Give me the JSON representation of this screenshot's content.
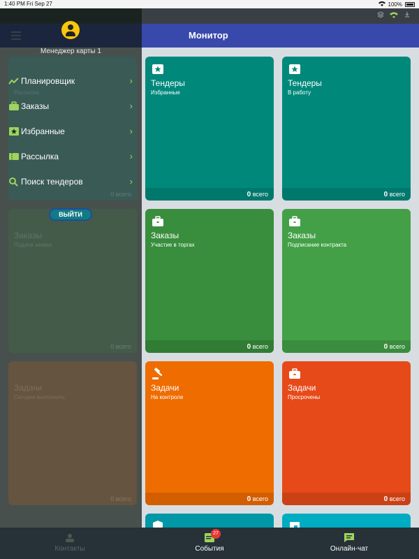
{
  "status": {
    "time": "1:40 PM",
    "date": "Fri Sep 27",
    "battery": "100%"
  },
  "header": {
    "title": "Монитор"
  },
  "drawer": {
    "username": "Менеджер карты 1",
    "items": [
      {
        "label": "Планировщик",
        "icon": "chart-line-icon"
      },
      {
        "label": "Заказы",
        "icon": "briefcase-icon"
      },
      {
        "label": "Избранные",
        "icon": "star-ticket-icon"
      },
      {
        "label": "Рассылка",
        "icon": "ticket-icon"
      },
      {
        "label": "Поиск тендеров",
        "icon": "search-icon"
      }
    ],
    "logout": "ВЫЙТИ",
    "ghost_cards": [
      {
        "t1": "",
        "t2": "Рассылка",
        "count": "0 всего"
      },
      {
        "t1": "Заказы",
        "t2": "Подача заявки",
        "count": "0 всего"
      },
      {
        "t1": "Задачи",
        "t2": "Сегодня выполнить",
        "count": "0 всего"
      }
    ]
  },
  "cards": [
    {
      "title": "Тендеры",
      "subtitle": "Избранные",
      "count": "0",
      "unit": "всего",
      "color": "#00897b",
      "icon": "star-ticket-icon"
    },
    {
      "title": "Тендеры",
      "subtitle": "В работу",
      "count": "0",
      "unit": "всего",
      "color": "#00897b",
      "icon": "star-ticket-icon"
    },
    {
      "title": "Заказы",
      "subtitle": "Участие в торгах",
      "count": "0",
      "unit": "всего",
      "color": "#388e3c",
      "icon": "briefcase-icon"
    },
    {
      "title": "Заказы",
      "subtitle": "Подписание контракта",
      "count": "0",
      "unit": "всего",
      "color": "#43a047",
      "icon": "briefcase-icon"
    },
    {
      "title": "Задачи",
      "subtitle": "На контроле",
      "count": "0",
      "unit": "всего",
      "color": "#ef6c00",
      "icon": "gavel-icon"
    },
    {
      "title": "Задачи",
      "subtitle": "Просрочены",
      "count": "0",
      "unit": "всего",
      "color": "#e64a19",
      "icon": "briefcase-icon"
    }
  ],
  "bottom_nav": {
    "contacts": "Контакты",
    "events": "События",
    "events_badge": "27",
    "chat": "Онлайн-чат"
  }
}
